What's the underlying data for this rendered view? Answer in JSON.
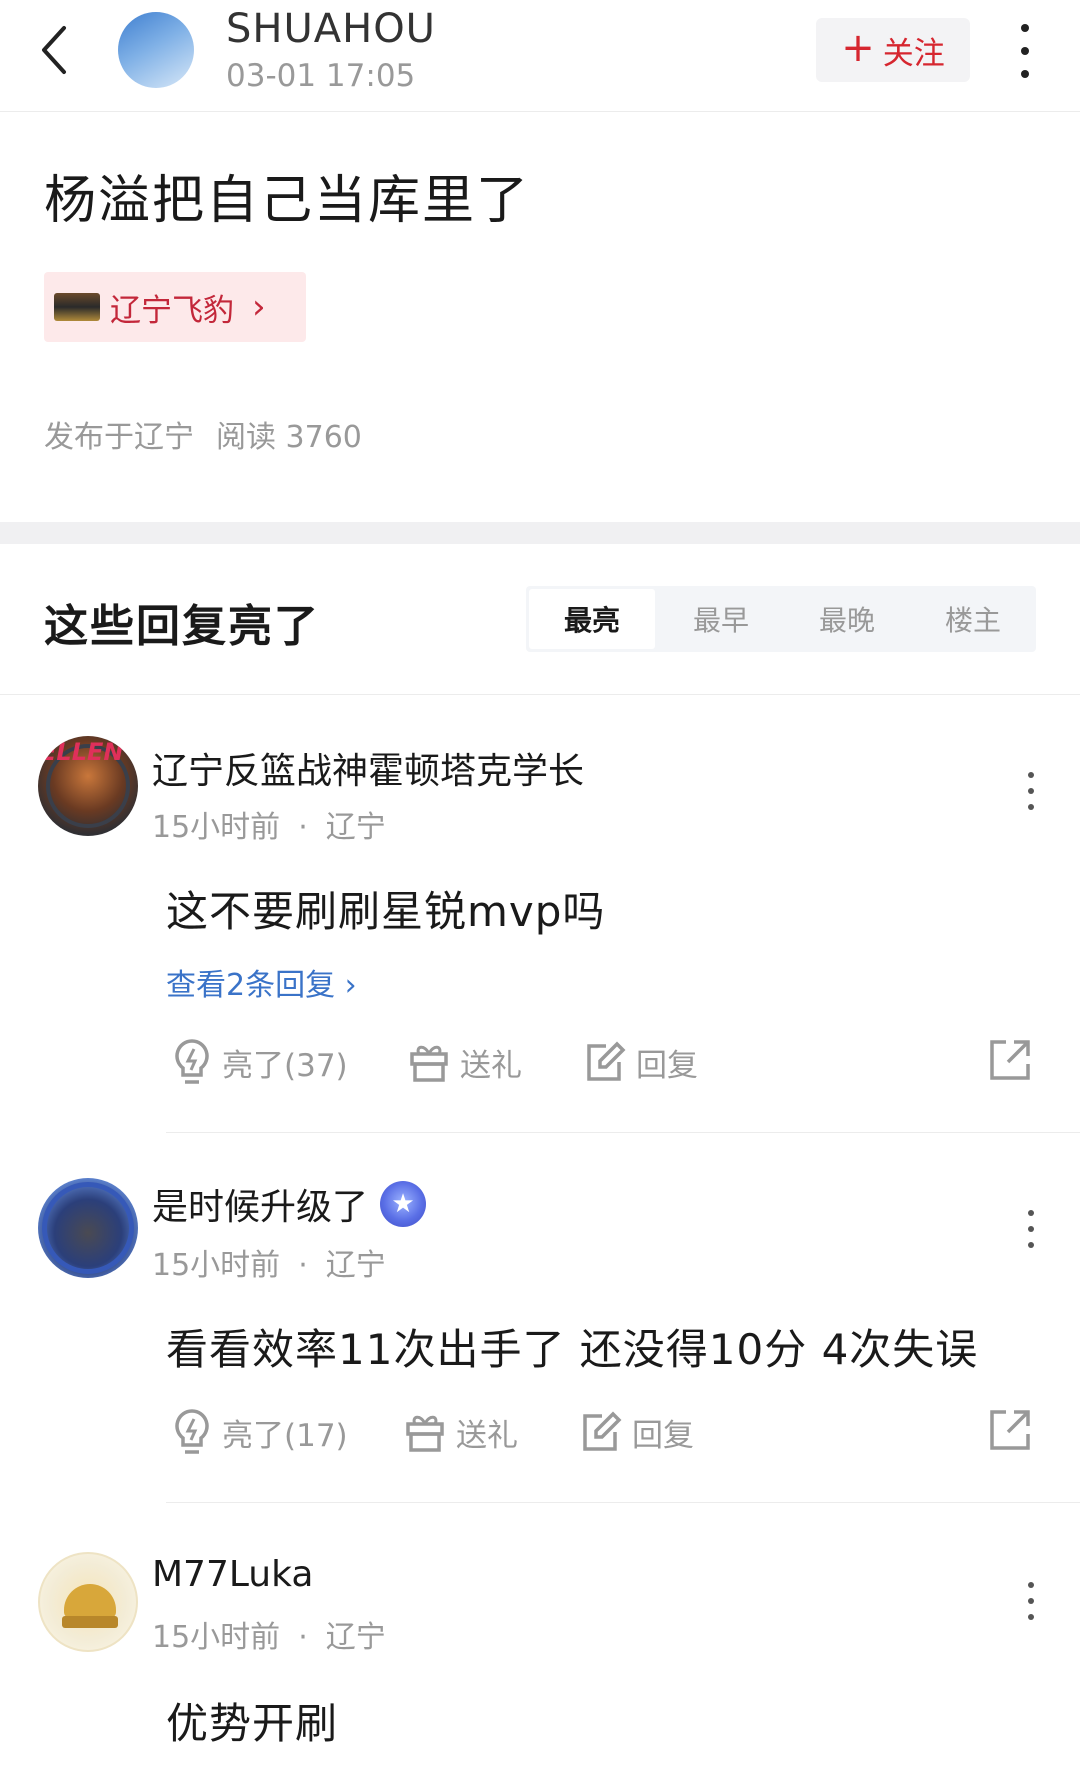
{
  "header": {
    "author_name": "SHUAHOU",
    "post_time": "03-01 17:05",
    "follow_plus": "+",
    "follow_label": "关注"
  },
  "post": {
    "title": "杨溢把自己当库里了",
    "tag_label": "辽宁飞豹",
    "tag_arrow": "›",
    "location": "发布于辽宁",
    "reads": "阅读 3760"
  },
  "replies_section": {
    "title": "这些回复亮了",
    "sort_tabs": [
      "最亮",
      "最早",
      "最晚",
      "楼主"
    ],
    "active_tab": "最亮"
  },
  "avatar_texts": {
    "c1": "ELLEN"
  },
  "badge_icon_text": "★",
  "comments": [
    {
      "username": "辽宁反篮战神霍顿塔克学长",
      "time": "15小时前",
      "location": "辽宁",
      "text": "这不要刷刷星锐mvp吗",
      "view_replies": "查看2条回复 ›",
      "like_label": "亮了(37)",
      "gift_label": "送礼",
      "reply_label": "回复"
    },
    {
      "username": "是时候升级了",
      "time": "15小时前",
      "location": "辽宁",
      "text": "看看效率11次出手了 还没得10分 4次失误",
      "like_label": "亮了(17)",
      "gift_label": "送礼",
      "reply_label": "回复"
    },
    {
      "username": "M77Luka",
      "time": "15小时前",
      "location": "辽宁",
      "text": "优势开刷"
    }
  ],
  "meta_separator": "·",
  "icons": {
    "back": "chevron-left-icon",
    "more": "more-vertical-icon",
    "like": "lightbulb-icon",
    "gift": "gift-icon",
    "reply": "edit-icon",
    "share": "share-icon"
  },
  "colors": {
    "accent_red": "#d6262f",
    "link_blue": "#3a73c8",
    "muted_text": "#999999"
  }
}
